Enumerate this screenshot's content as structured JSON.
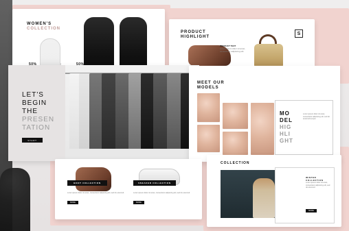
{
  "slides": {
    "women": {
      "title": "WOMEN'S",
      "subtitle": "COLLECTION",
      "badges": [
        "50%",
        "50%",
        "50%"
      ]
    },
    "product": {
      "title": "PRODUCT",
      "subtitle": "HIGHLIGHT",
      "kicker": "PRODUCT TEXT",
      "text": "Lorem ipsum dolor sit amet, consectetur adipiscing elit.",
      "badge": "S"
    },
    "intro": {
      "line1": "LET'S",
      "line2": "BEGIN",
      "line3": "THE",
      "line4": "PRESEN",
      "line5": "TATION",
      "button": "START"
    },
    "models": {
      "title": "MEET OUR",
      "subtitle": "MODELS",
      "right_title_1": "MO",
      "right_title_2": "DEL",
      "right_title_3": "HIG",
      "right_title_4": "HLI",
      "right_title_5": "GHT",
      "text": "Lorem ipsum dolor sit amet, consectetur adipiscing elit, sed do eiusmod tempor."
    },
    "boots": {
      "label_left": "BOOT COLLECTION",
      "label_right": "SNEAKER COLLECTION",
      "desc_left": "Lorem ipsum dolor sit amet, consectetur adipiscing elit, sed do eiusmod.",
      "desc_right": "Lorem ipsum dolor sit amet, consectetur adipiscing elit, sed do eiusmod.",
      "btn_left": "MORE",
      "btn_right": "MORE"
    },
    "collection": {
      "title": "COLLECTION",
      "right_title": "WINTER COLLECTION",
      "text": "Lorem ipsum dolor sit amet, consectetur adipiscing elit, sed do eiusmod.",
      "button": "MORE"
    }
  }
}
